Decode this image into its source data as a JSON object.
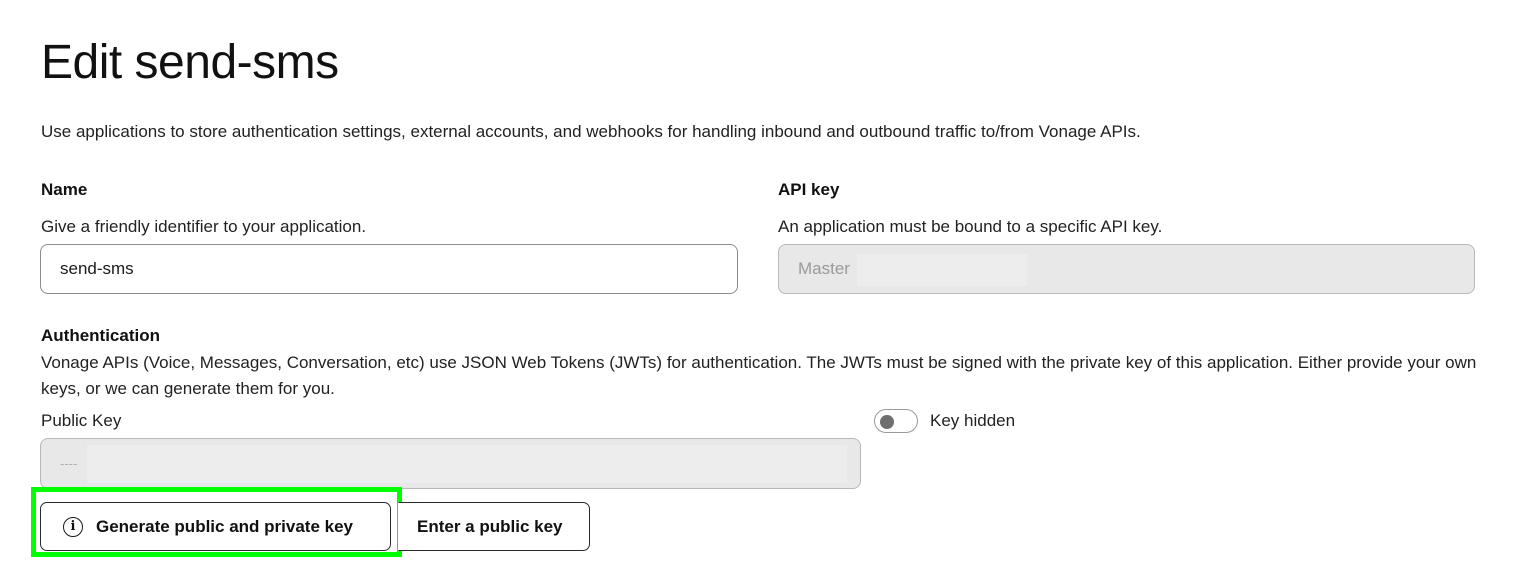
{
  "page": {
    "title": "Edit send-sms",
    "description": "Use applications to store authentication settings, external accounts, and webhooks for handling inbound and outbound traffic to/from Vonage APIs."
  },
  "name_field": {
    "label": "Name",
    "help": "Give a friendly identifier to your application.",
    "value": "send-sms"
  },
  "api_key_field": {
    "label": "API key",
    "help": "An application must be bound to a specific API key.",
    "value": "Master"
  },
  "authentication": {
    "label": "Authentication",
    "description": "Vonage APIs (Voice, Messages, Conversation, etc) use JSON Web Tokens (JWTs) for authentication. The JWTs must be signed with the private key of this application. Either provide your own keys, or we can generate them for you.",
    "public_key_label": "Public Key",
    "public_key_value": "----",
    "toggle_label": "Key hidden",
    "toggle_on": false,
    "generate_button": "Generate public and private key",
    "enter_button": "Enter a public key",
    "generate_icon": "info-icon"
  },
  "colors": {
    "highlight": "#00ff00"
  }
}
